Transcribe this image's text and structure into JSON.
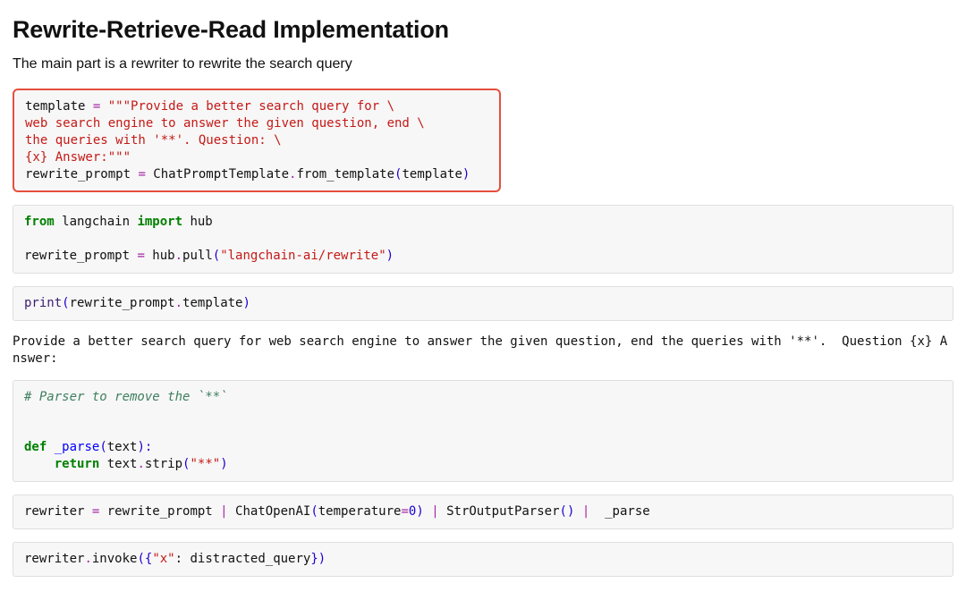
{
  "title": "Rewrite-Retrieve-Read Implementation",
  "intro": "The main part is a rewriter to rewrite the search query",
  "code1": {
    "l1a": "template ",
    "l1b": "=",
    "l1c": " ",
    "l1d": "\"\"\"Provide a better search query for \\",
    "l2": "web search engine to answer the given question, end \\",
    "l3": "the queries with '**'. Question: \\",
    "l4": "{x} Answer:\"\"\"",
    "l5a": "rewrite_prompt ",
    "l5b": "=",
    "l5c": " ChatPromptTemplate",
    "l5d": ".",
    "l5e": "from_template",
    "l5f": "(",
    "l5g": "template",
    "l5h": ")"
  },
  "code2": {
    "l1a": "from",
    "l1b": " langchain ",
    "l1c": "import",
    "l1d": " hub",
    "l3a": "rewrite_prompt ",
    "l3b": "=",
    "l3c": " hub",
    "l3d": ".",
    "l3e": "pull",
    "l3f": "(",
    "l3g": "\"langchain-ai/rewrite\"",
    "l3h": ")"
  },
  "code3": {
    "l1a": "print",
    "l1b": "(",
    "l1c": "rewrite_prompt",
    "l1d": ".",
    "l1e": "template",
    "l1f": ")"
  },
  "output1": "Provide a better search query for web search engine to answer the given question, end the queries with '**'.  Question {x} Answer:",
  "code4": {
    "l1": "# Parser to remove the `**`",
    "l4a": "def",
    "l4b": " ",
    "l4c": "_parse",
    "l4d": "(",
    "l4e": "text",
    "l4f": "):",
    "l5a": "    ",
    "l5b": "return",
    "l5c": " text",
    "l5d": ".",
    "l5e": "strip",
    "l5f": "(",
    "l5g": "\"**\"",
    "l5h": ")"
  },
  "code5": {
    "l1a": "rewriter ",
    "l1b": "=",
    "l1c": " rewrite_prompt ",
    "l1d": "|",
    "l1e": " ChatOpenAI",
    "l1f": "(",
    "l1g": "temperature",
    "l1h": "=",
    "l1i": "0",
    "l1j": ")",
    "l1k": " ",
    "l1l": "|",
    "l1m": " StrOutputParser",
    "l1n": "(",
    "l1o": ")",
    "l1p": " ",
    "l1q": "|",
    "l1r": "  _parse"
  },
  "code6": {
    "l1a": "rewriter",
    "l1b": ".",
    "l1c": "invoke",
    "l1d": "(",
    "l1e": "{",
    "l1f": "\"x\"",
    "l1g": ": ",
    "l1h": "distracted_query",
    "l1i": "}",
    "l1j": ")"
  }
}
